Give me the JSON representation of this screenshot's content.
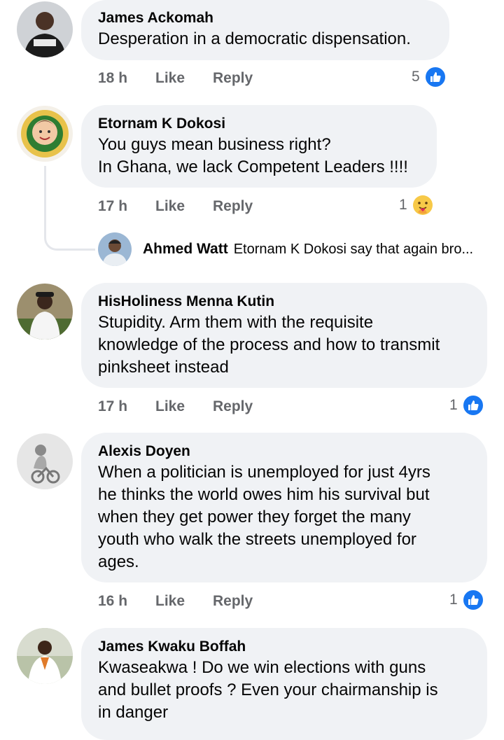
{
  "comments": [
    {
      "author": "James Ackomah",
      "lines": [
        "Desperation in a democratic dispensation."
      ],
      "time": "18 h",
      "like_label": "Like",
      "reply_label": "Reply",
      "reaction_count": "5",
      "reaction_icon": "like-icon"
    },
    {
      "author": "Etornam K Dokosi",
      "lines": [
        "You guys mean business right?",
        "In Ghana, we lack Competent Leaders !!!!"
      ],
      "time": "17 h",
      "like_label": "Like",
      "reply_label": "Reply",
      "reaction_count": "1",
      "reaction_icon": "care-emoji-icon",
      "reply_preview": {
        "author": "Ahmed Watt",
        "snippet": "Etornam K Dokosi say that again bro..."
      }
    },
    {
      "author": "HisHoliness Menna Kutin",
      "lines": [
        "Stupidity. Arm them with the requisite",
        "knowledge of the process and how to transmit",
        "pinksheet instead"
      ],
      "time": "17 h",
      "like_label": "Like",
      "reply_label": "Reply",
      "reaction_count": "1",
      "reaction_icon": "like-icon"
    },
    {
      "author": "Alexis Doyen",
      "lines": [
        "When a politician is unemployed for just 4yrs",
        "he thinks the world owes him his survival but",
        "when they get power they forget the many",
        "youth who walk the streets unemployed for",
        "ages."
      ],
      "time": "16 h",
      "like_label": "Like",
      "reply_label": "Reply",
      "reaction_count": "1",
      "reaction_icon": "like-icon"
    },
    {
      "author": "James Kwaku Boffah",
      "lines": [
        "Kwaseakwa ! Do we win elections with guns",
        "and bullet proofs ? Even your chairmanship is",
        "in danger"
      ]
    }
  ],
  "colors": {
    "bubble": "#f0f2f5",
    "meta": "#65676b",
    "like_blue": "#1877f2",
    "text": "#050505"
  }
}
